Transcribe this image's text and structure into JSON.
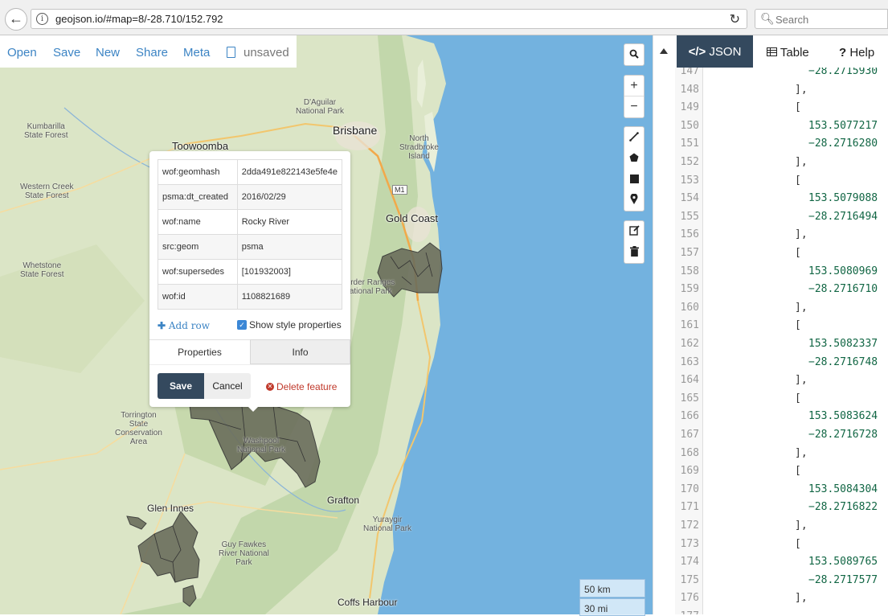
{
  "browser": {
    "url": "geojson.io/#map=8/-28.710/152.792",
    "search_placeholder": "Search"
  },
  "menu": {
    "open": "Open",
    "save": "Save",
    "new": "New",
    "share": "Share",
    "meta": "Meta",
    "status": "unsaved"
  },
  "map_labels": {
    "brisbane": "Brisbane",
    "toowoomba": "Toowoomba",
    "gold_coast": "Gold Coast",
    "grafton": "Grafton",
    "glen_innes": "Glen Innes",
    "coffs_harbour": "Coffs Harbour",
    "kumbarilla": "Kumbarilla\nState Forest",
    "western_creek": "Western Creek\nState Forest",
    "whetstone": "Whetstone\nState Forest",
    "daguilar": "D'Aguilar\nNational Park",
    "north_stradbroke": "North\nStradbroke\nIsland",
    "torrington": "Torrington\nState\nConservation\nArea",
    "washpool": "Washpool\nNational Park",
    "guy_fawkes": "Guy Fawkes\nRiver National\nPark",
    "yuraygir": "Yuraygir\nNational Park",
    "border_ranges": "Border Ranges\nNational Park",
    "m1": "M1"
  },
  "popup": {
    "properties": [
      {
        "key": "wof:geomhash",
        "value": "2dda491e822143e5fe4e"
      },
      {
        "key": "psma:dt_created",
        "value": "2016/02/29"
      },
      {
        "key": "wof:name",
        "value": "Rocky River"
      },
      {
        "key": "src:geom",
        "value": "psma"
      },
      {
        "key": "wof:supersedes",
        "value": "[101932003]"
      },
      {
        "key": "wof:id",
        "value": "1108821689"
      }
    ],
    "add_row": "Add row",
    "show_style": "Show style properties",
    "show_style_checked": true,
    "tab_properties": "Properties",
    "tab_info": "Info",
    "save": "Save",
    "cancel": "Cancel",
    "delete": "Delete feature"
  },
  "scale": {
    "km": "50 km",
    "mi": "30 mi"
  },
  "panel": {
    "tab_json": "JSON",
    "tab_table": "Table",
    "tab_help": "Help",
    "active_tab": "JSON"
  },
  "code_lines": [
    {
      "n": "147",
      "text": "−28.2715930"
    },
    {
      "n": "148",
      "text": "],"
    },
    {
      "n": "149",
      "text": "["
    },
    {
      "n": "150",
      "text": "153.5077217"
    },
    {
      "n": "151",
      "text": "−28.2716280"
    },
    {
      "n": "152",
      "text": "],"
    },
    {
      "n": "153",
      "text": "["
    },
    {
      "n": "154",
      "text": "153.5079088"
    },
    {
      "n": "155",
      "text": "−28.2716494"
    },
    {
      "n": "156",
      "text": "],"
    },
    {
      "n": "157",
      "text": "["
    },
    {
      "n": "158",
      "text": "153.5080969"
    },
    {
      "n": "159",
      "text": "−28.2716710"
    },
    {
      "n": "160",
      "text": "],"
    },
    {
      "n": "161",
      "text": "["
    },
    {
      "n": "162",
      "text": "153.5082337"
    },
    {
      "n": "163",
      "text": "−28.2716748"
    },
    {
      "n": "164",
      "text": "],"
    },
    {
      "n": "165",
      "text": "["
    },
    {
      "n": "166",
      "text": "153.5083624"
    },
    {
      "n": "167",
      "text": "−28.2716728"
    },
    {
      "n": "168",
      "text": "],"
    },
    {
      "n": "169",
      "text": "["
    },
    {
      "n": "170",
      "text": "153.5084304"
    },
    {
      "n": "171",
      "text": "−28.2716822"
    },
    {
      "n": "172",
      "text": "],"
    },
    {
      "n": "173",
      "text": "["
    },
    {
      "n": "174",
      "text": "153.5089765"
    },
    {
      "n": "175",
      "text": "−28.2717577"
    },
    {
      "n": "176",
      "text": "],"
    },
    {
      "n": "177",
      "text": ""
    }
  ],
  "colors": {
    "accent": "#3c84c4",
    "dark_button": "#34495e",
    "delete": "#c0392b",
    "ocean": "#73b2df",
    "land": "#dbe5c6",
    "feature_fill": "#6b6e5c"
  },
  "icons": {
    "back": "arrow-left",
    "reload": "circular-arrow",
    "search": "magnifier",
    "map_tools": [
      "search",
      "zoom-in",
      "zoom-out",
      "draw-line",
      "draw-polygon",
      "draw-rectangle",
      "draw-marker",
      "edit",
      "delete"
    ]
  }
}
